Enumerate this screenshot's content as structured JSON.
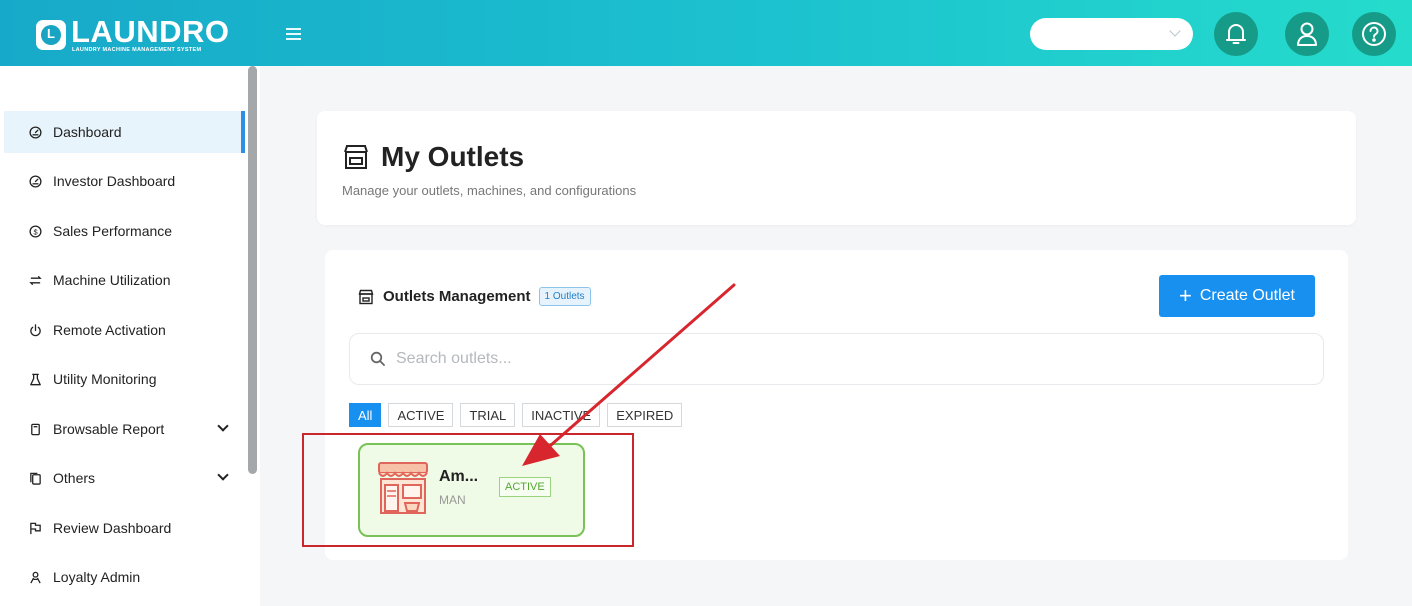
{
  "header": {
    "logo_letter": "L",
    "logo_text": "LAUNDRO",
    "logo_subtitle": "LAUNDRY MACHINE MANAGEMENT SYSTEM",
    "select_value": "",
    "icons": [
      "menu-icon",
      "bell-icon",
      "user-icon",
      "help-icon"
    ]
  },
  "sidebar": {
    "items": [
      {
        "label": "Dashboard",
        "icon": "gauge-icon"
      },
      {
        "label": "Investor Dashboard",
        "icon": "gauge-icon"
      },
      {
        "label": "Sales Performance",
        "icon": "dollar-icon"
      },
      {
        "label": "Machine Utilization",
        "icon": "swap-icon"
      },
      {
        "label": "Remote Activation",
        "icon": "power-icon"
      },
      {
        "label": "Utility Monitoring",
        "icon": "flask-icon"
      },
      {
        "label": "Browsable Report",
        "icon": "file-icon"
      },
      {
        "label": "Others",
        "icon": "copy-icon"
      },
      {
        "label": "Review Dashboard",
        "icon": "flag-icon"
      },
      {
        "label": "Loyalty Admin",
        "icon": "users-icon"
      }
    ]
  },
  "page": {
    "title": "My Outlets",
    "subtitle": "Manage your outlets, machines, and configurations"
  },
  "management": {
    "title": "Outlets Management",
    "count_label": "1 Outlets",
    "create_label": "Create Outlet",
    "search_placeholder": "Search outlets...",
    "filters": [
      "All",
      "ACTIVE",
      "TRIAL",
      "INACTIVE",
      "EXPIRED"
    ],
    "outlets": [
      {
        "name": "Am...",
        "code": "MAN",
        "status": "ACTIVE"
      }
    ]
  },
  "colors": {
    "header_start": "#17a9c9",
    "header_end": "#25dccc",
    "header_button": "#159b88",
    "primary": "#1890f0",
    "active_green": "#78c257",
    "annotation_red": "#c9262e"
  }
}
